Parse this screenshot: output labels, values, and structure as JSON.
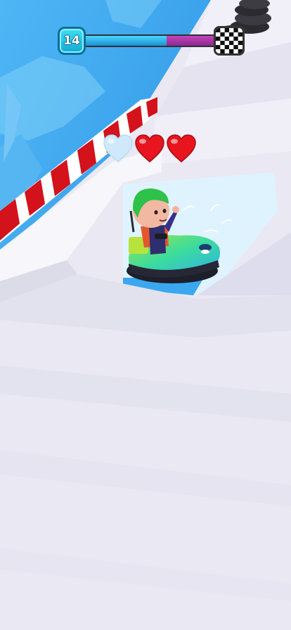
{
  "hud": {
    "level": "14",
    "progress_fraction": 0.62,
    "finish_icon": "checkered-flag-icon"
  },
  "lives": {
    "total": 3,
    "lost": 1,
    "heart_icon": "heart-icon",
    "colors": {
      "full": "#e8141e",
      "lost": "#cfe9fb"
    }
  },
  "colors": {
    "track": "#e9e8f3",
    "water": "#3aa3ec",
    "barrier_red": "#d3121c",
    "kart_body": "#38d97a",
    "player_hair": "#35c24a"
  }
}
